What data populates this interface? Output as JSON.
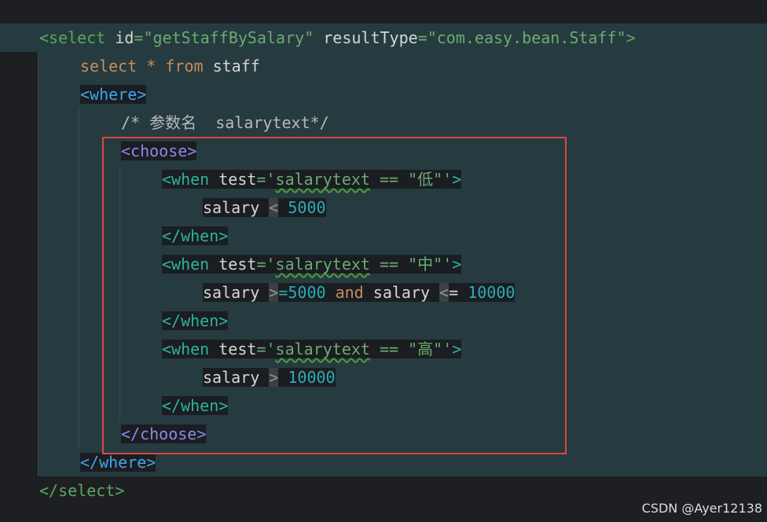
{
  "lines": [
    {
      "segments": [
        {
          "text": "<select",
          "cls": "tag-sel"
        },
        {
          "text": " id",
          "cls": "sel-attr"
        },
        {
          "text": "=\"getStaffBySalary\"",
          "cls": "sel-val"
        },
        {
          "text": " resultType",
          "cls": "sel-attr"
        },
        {
          "text": "=\"com.easy.bean.Staff\"",
          "cls": "sel-val"
        },
        {
          "text": ">",
          "cls": "tag-sel"
        }
      ]
    },
    {
      "segments": [
        {
          "text": "select",
          "cls": "sql-kw"
        },
        {
          "text": " ",
          "cls": "sql-id"
        },
        {
          "text": "*",
          "cls": "sql-kw"
        },
        {
          "text": " from",
          "cls": "sql-kw"
        },
        {
          "text": " staff",
          "cls": "sql-id"
        }
      ]
    },
    {
      "segments": [
        {
          "text": "<where>",
          "cls": "where-tag"
        }
      ]
    },
    {
      "segments": [
        {
          "text": "/* 参数名  salarytext*/",
          "cls": "comment"
        }
      ]
    },
    {
      "segments": [
        {
          "text": "<choose>",
          "cls": "choose-tag"
        }
      ]
    },
    {
      "segments": [
        {
          "text": "<when",
          "cls": "when-tag"
        },
        {
          "text": " test",
          "cls": "attr-name"
        },
        {
          "text": "='",
          "cls": "test-expr"
        },
        {
          "text": "salarytext",
          "cls": "test-expr squiggle"
        },
        {
          "text": " == \"低\"'",
          "cls": "test-expr"
        },
        {
          "text": ">",
          "cls": "when-tag"
        }
      ]
    },
    {
      "segments": [
        {
          "text": "salary ",
          "cls": "sql-id"
        },
        {
          "text": "<",
          "cls": "op-bg"
        },
        {
          "text": " 5000",
          "cls": "num"
        }
      ]
    },
    {
      "segments": [
        {
          "text": "</when>",
          "cls": "when-tag"
        }
      ]
    },
    {
      "segments": [
        {
          "text": "<when",
          "cls": "when-tag"
        },
        {
          "text": " test",
          "cls": "attr-name"
        },
        {
          "text": "='",
          "cls": "test-expr"
        },
        {
          "text": "salarytext",
          "cls": "test-expr squiggle"
        },
        {
          "text": " == \"中\"'",
          "cls": "test-expr"
        },
        {
          "text": ">",
          "cls": "when-tag"
        }
      ]
    },
    {
      "segments": [
        {
          "text": "salary ",
          "cls": "sql-id"
        },
        {
          "text": ">",
          "cls": "op-bg"
        },
        {
          "text": "=5000",
          "cls": "num"
        },
        {
          "text": " and",
          "cls": "and-kw"
        },
        {
          "text": " salary ",
          "cls": "sql-id"
        },
        {
          "text": "<",
          "cls": "op-bg"
        },
        {
          "text": "= ",
          "cls": "sql-id"
        },
        {
          "text": "10000",
          "cls": "num"
        }
      ]
    },
    {
      "segments": [
        {
          "text": "</when>",
          "cls": "when-tag"
        }
      ]
    },
    {
      "segments": [
        {
          "text": "<when",
          "cls": "when-tag"
        },
        {
          "text": " test",
          "cls": "attr-name"
        },
        {
          "text": "='",
          "cls": "test-expr"
        },
        {
          "text": "salarytext",
          "cls": "test-expr squiggle"
        },
        {
          "text": " == \"高\"'",
          "cls": "test-expr"
        },
        {
          "text": ">",
          "cls": "when-tag"
        }
      ]
    },
    {
      "segments": [
        {
          "text": "salary ",
          "cls": "sql-id"
        },
        {
          "text": ">",
          "cls": "op-bg"
        },
        {
          "text": " 10000",
          "cls": "num"
        }
      ]
    },
    {
      "segments": [
        {
          "text": "</when>",
          "cls": "when-tag"
        }
      ]
    },
    {
      "segments": [
        {
          "text": "</choose>",
          "cls": "choose-tag"
        }
      ]
    },
    {
      "segments": [
        {
          "text": "</where>",
          "cls": "where-tag"
        }
      ]
    },
    {
      "segments": [
        {
          "text": "</select>",
          "cls": "tag-sel"
        }
      ]
    }
  ],
  "watermark": "CSDN @Ayer12138",
  "colors": {
    "background": "#1e1f22",
    "band": "#263b3f",
    "highlight_box": "#e04444"
  }
}
